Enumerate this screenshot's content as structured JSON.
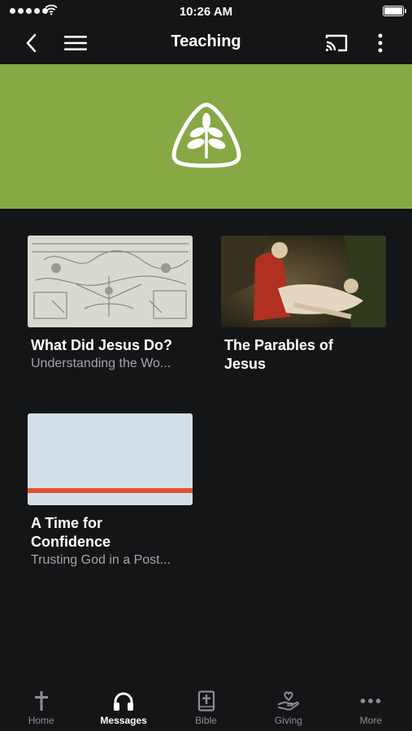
{
  "status": {
    "time": "10:26 AM"
  },
  "header": {
    "title": "Teaching"
  },
  "colors": {
    "hero_bg": "#87a845",
    "background": "#141517",
    "accent_stripe": "#e0522b"
  },
  "cards": [
    {
      "title": "What Did Jesus Do?",
      "subtitle": "Understanding the Wo..."
    },
    {
      "title": "The Parables of Jesus",
      "subtitle": ""
    },
    {
      "title": "A Time for Confidence",
      "subtitle": "Trusting God in a Post..."
    }
  ],
  "tabs": [
    {
      "label": "Home",
      "icon": "cross-icon"
    },
    {
      "label": "Messages",
      "icon": "headphones-icon"
    },
    {
      "label": "Bible",
      "icon": "bible-icon"
    },
    {
      "label": "Giving",
      "icon": "giving-hand-icon"
    },
    {
      "label": "More",
      "icon": "more-dots-icon"
    }
  ]
}
